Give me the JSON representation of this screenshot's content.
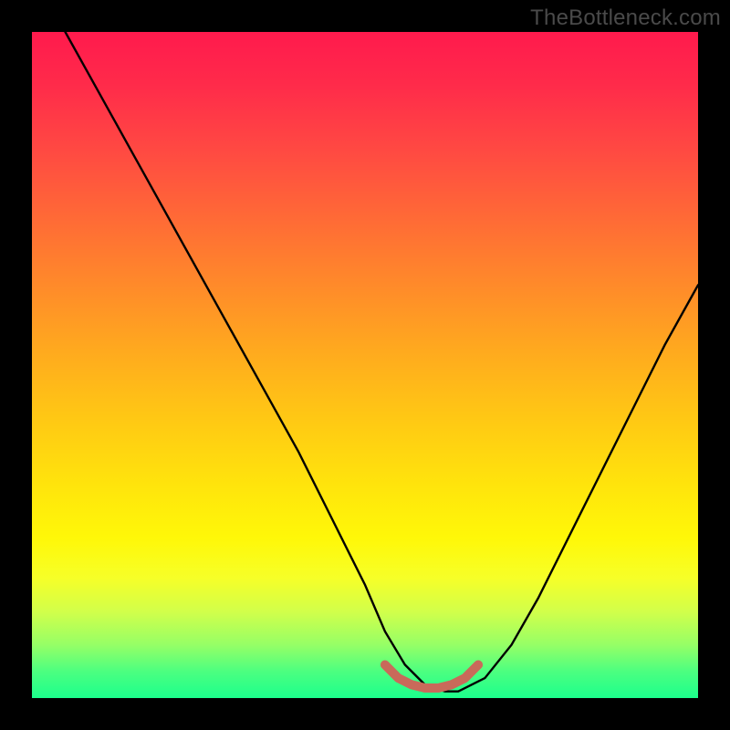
{
  "watermark": "TheBottleneck.com",
  "chart_data": {
    "type": "line",
    "title": "",
    "xlabel": "",
    "ylabel": "",
    "xlim": [
      0,
      100
    ],
    "ylim": [
      0,
      100
    ],
    "series": [
      {
        "name": "curve",
        "color": "#000000",
        "x": [
          5,
          10,
          15,
          20,
          25,
          30,
          35,
          40,
          45,
          50,
          53,
          56,
          59,
          62,
          64,
          68,
          72,
          76,
          80,
          85,
          90,
          95,
          100
        ],
        "y": [
          100,
          91,
          82,
          73,
          64,
          55,
          46,
          37,
          27,
          17,
          10,
          5,
          2,
          1,
          1,
          3,
          8,
          15,
          23,
          33,
          43,
          53,
          62
        ]
      },
      {
        "name": "highlight",
        "color": "#c96a5a",
        "x": [
          53,
          55,
          57,
          59,
          61,
          63,
          65,
          67
        ],
        "y": [
          5,
          3,
          2,
          1.5,
          1.5,
          2,
          3,
          5
        ]
      }
    ],
    "background_gradient": {
      "top": "#ff1a4d",
      "mid": "#ffe40c",
      "bottom": "#1cff8c"
    }
  }
}
